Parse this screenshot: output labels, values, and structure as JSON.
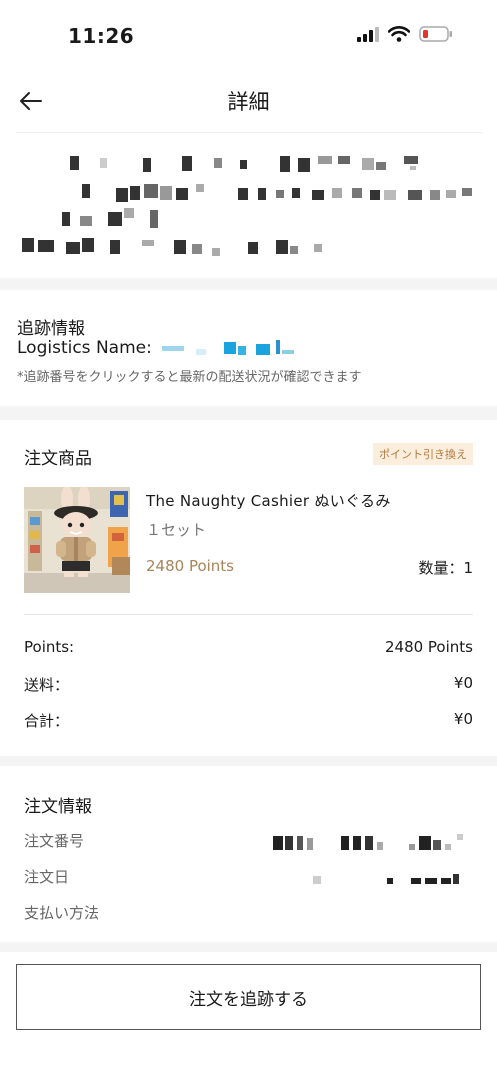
{
  "status_bar": {
    "time": "11:26"
  },
  "nav": {
    "title": "詳細"
  },
  "tracking": {
    "title": "追跡情報",
    "logistics_label": "Logistics Name:",
    "note": "*追跡番号をクリックすると最新の配送状況が確認できます"
  },
  "product": {
    "section_title": "注文商品",
    "badge": "ポイント引き換え",
    "name": "The Naughty Cashier ぬいぐるみ",
    "set": "１セット",
    "points": "2480 Points",
    "quantity": "数量：1",
    "summary": [
      {
        "label": "Points:",
        "value": "2480  Points"
      },
      {
        "label": "送料：",
        "value": "¥0"
      },
      {
        "label": "合計：",
        "value": "¥0"
      }
    ]
  },
  "order_info": {
    "title": "注文情報",
    "number_label": "注文番号",
    "date_label": "注文日",
    "payment_label": "支払い方法"
  },
  "action": {
    "track_button": "注文を追跡する"
  },
  "colors": {
    "points": "#a8845a",
    "badge_bg": "#fbeedd",
    "badge_text": "#b07a40",
    "section_gap": "#f4f4f4"
  }
}
